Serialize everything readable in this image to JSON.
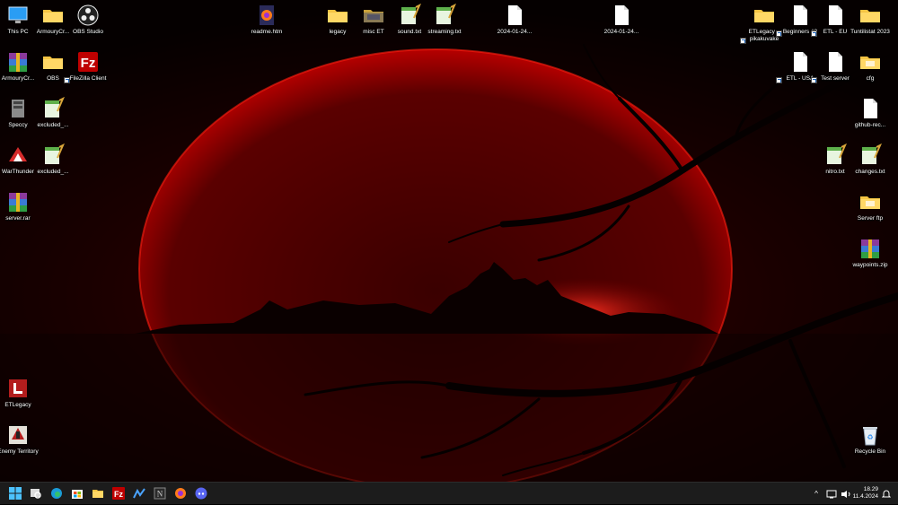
{
  "desktop_icons": {
    "this_pc": "This PC",
    "armoury_folder": "ArmouryCr...",
    "obs_studio": "OBS Studio",
    "readme": "readme.htm",
    "legacy": "legacy",
    "misc_et": "misc ET",
    "sound_txt": "sound.txt",
    "streaming_txt": "streaming.txt",
    "date_file_1": "2024-01-24...",
    "date_file_2": "2024-01-24...",
    "etlegacy_shortcut": "ETLegacy – pikakuvake",
    "beginners": "Beginners #2",
    "etl_eu": "ETL - EU",
    "tuntilistat": "Tuntilistat 2023",
    "armoury_rar": "ArmouryCr...",
    "obs_folder": "OBS",
    "filezilla": "FileZilla Client",
    "etl_usa": "ETL - USA",
    "test_server": "Test server",
    "cfg": "cfg",
    "speccy": "Speccy",
    "excluded_1": "excluded_...",
    "github_rec": "github-rec...",
    "warthunder": "WarThunder",
    "excluded_2": "excluded_...",
    "nitro": "nitro.txt",
    "changes": "changes.txt",
    "server_rar": "server.rar",
    "server_ftp": "Server ftp",
    "waypoints": "waypoints.zip",
    "etlegacy": "ETLegacy",
    "enemy_territory": "Enemy Territory",
    "recycle_bin": "Recycle Bin"
  },
  "taskbar": {
    "clock_time": "18.29",
    "clock_date": "11.4.2024",
    "tray_chevron": "^"
  },
  "colors": {
    "taskbar": "#1c1c1c",
    "folder": "#f5c443",
    "moon": "#b30000",
    "accent": "#0078d4"
  }
}
